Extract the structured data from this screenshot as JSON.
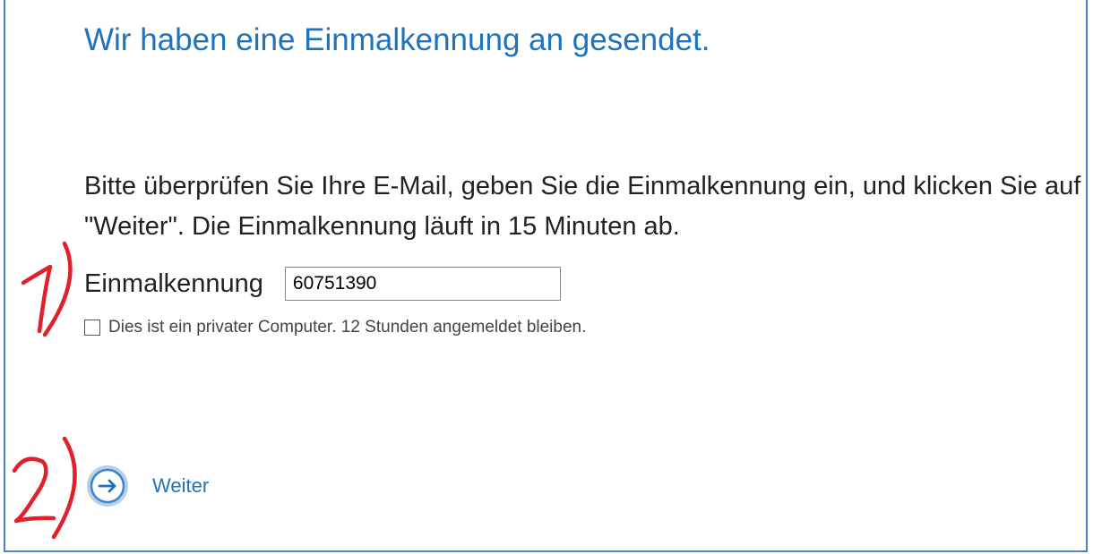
{
  "header": {
    "title": "Wir haben eine Einmalkennung an gesendet."
  },
  "body": {
    "instructions": "Bitte überprüfen Sie Ihre E-Mail, geben Sie die Einmalkennung ein, und klicken Sie auf \"Weiter\". Die Einmalkennung läuft in 15 Minuten ab."
  },
  "form": {
    "code_label": "Einmalkennung",
    "code_value": "60751390",
    "private_computer_label": "Dies ist ein privater Computer. 12 Stunden angemeldet bleiben.",
    "private_computer_checked": false
  },
  "actions": {
    "next_label": "Weiter",
    "next_icon": "arrow-right-circle-icon"
  },
  "annotations": {
    "step1": "1)",
    "step2": "2)",
    "color": "#e0202a"
  },
  "colors": {
    "accent": "#1e73be",
    "frame": "#4a83c4"
  }
}
